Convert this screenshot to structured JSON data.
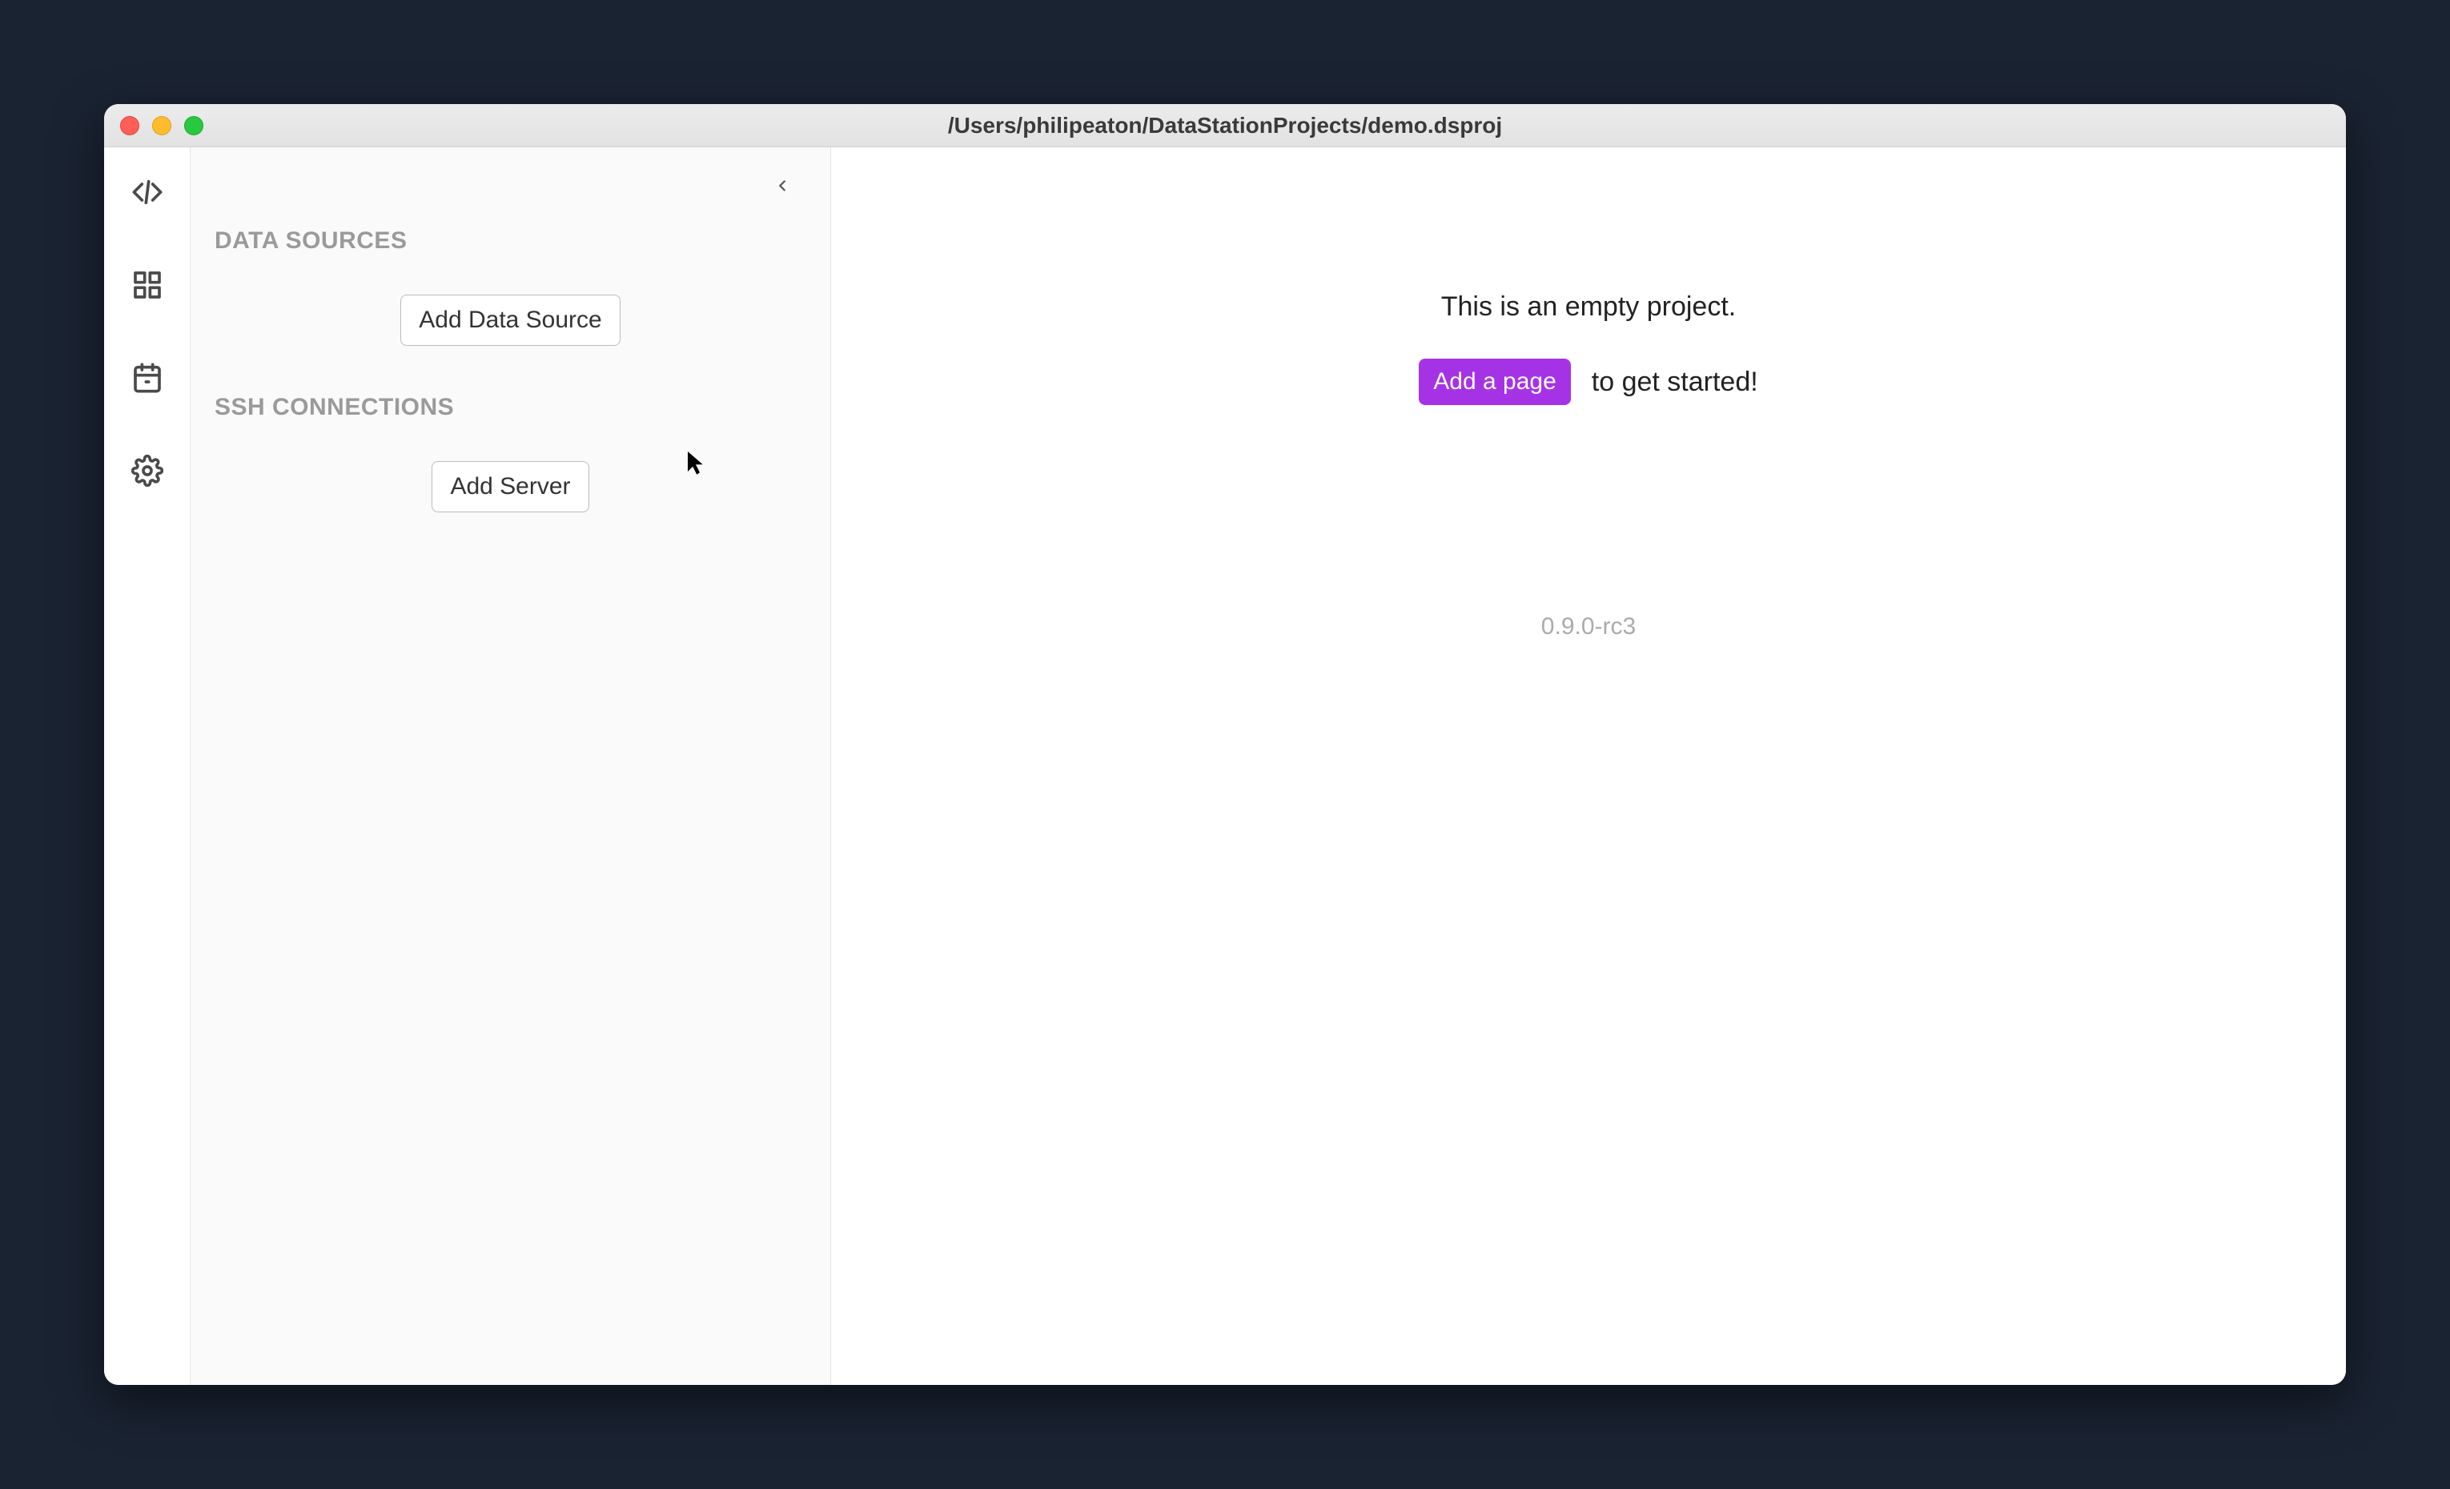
{
  "window": {
    "title": "/Users/philipeaton/DataStationProjects/demo.dsproj"
  },
  "sidebar": {
    "data_sources_heading": "Data Sources",
    "add_data_source_label": "Add Data Source",
    "ssh_heading": "SSH Connections",
    "add_server_label": "Add Server"
  },
  "main": {
    "empty_message": "This is an empty project.",
    "add_page_label": "Add a page",
    "cta_suffix": "to get started!",
    "version": "0.9.0-rc3"
  },
  "colors": {
    "accent": "#a632e6"
  }
}
